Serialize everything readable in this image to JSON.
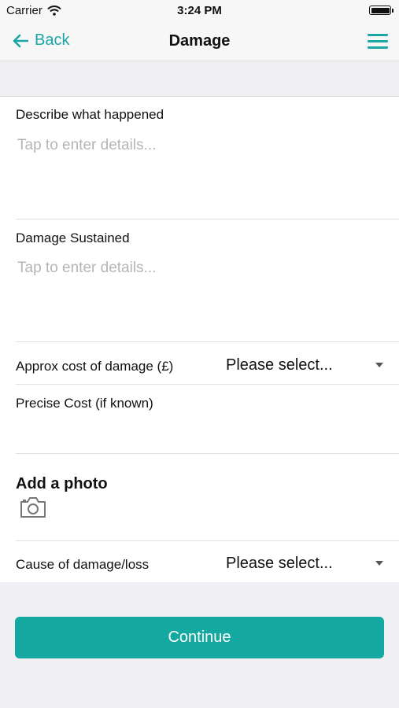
{
  "status_bar": {
    "carrier": "Carrier",
    "time": "3:24 PM"
  },
  "nav": {
    "back_label": "Back",
    "title": "Damage"
  },
  "form": {
    "describe": {
      "label": "Describe what happened",
      "placeholder": "Tap to enter details..."
    },
    "damage_sustained": {
      "label": "Damage Sustained",
      "placeholder": "Tap to enter details..."
    },
    "approx_cost": {
      "label": "Approx cost of damage (£)",
      "value": "Please select..."
    },
    "precise_cost": {
      "label": "Precise Cost (if known)"
    },
    "photo": {
      "label": "Add a photo"
    },
    "cause": {
      "label": "Cause of damage/loss",
      "value": "Please select..."
    }
  },
  "continue_label": "Continue",
  "colors": {
    "accent": "#13a8a0",
    "link": "#1aa6a6",
    "background": "#efeff4"
  },
  "icons": [
    "wifi-icon",
    "battery-icon",
    "back-arrow-icon",
    "menu-icon",
    "camera-icon",
    "dropdown-caret-icon"
  ]
}
